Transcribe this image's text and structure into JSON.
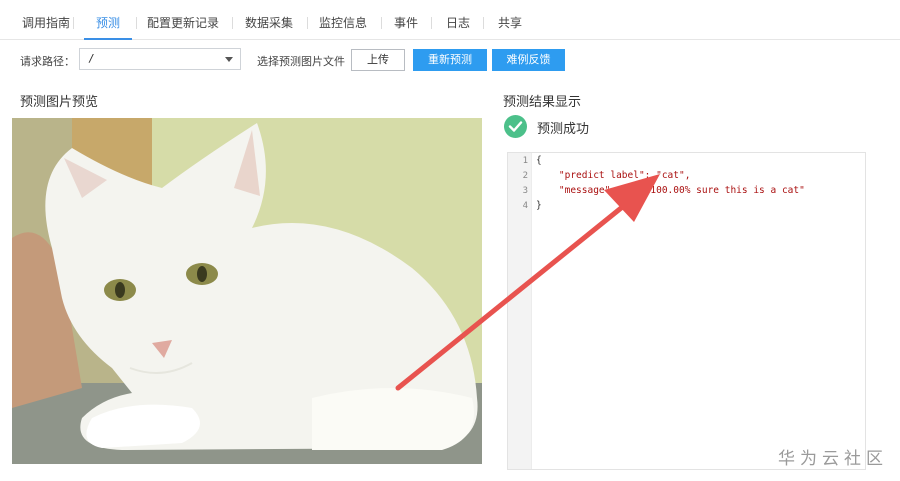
{
  "tabs": [
    {
      "label": "调用指南"
    },
    {
      "label": "预测",
      "active": true
    },
    {
      "label": "配置更新记录"
    },
    {
      "label": "数据采集"
    },
    {
      "label": "监控信息"
    },
    {
      "label": "事件"
    },
    {
      "label": "日志"
    },
    {
      "label": "共享"
    }
  ],
  "toolbar": {
    "path_label": "请求路径：",
    "path_value": "/",
    "file_label": "选择预测图片文件",
    "upload_button": "上传",
    "repredict_button": "重新预测",
    "feedback_button": "难例反馈"
  },
  "preview": {
    "title": "预测图片预览"
  },
  "result": {
    "title": "预测结果显示",
    "status": "预测成功",
    "code_lines": [
      {
        "num": "1",
        "text": "{"
      },
      {
        "num": "2",
        "text": "    \"predict label\": \"cat\","
      },
      {
        "num": "3",
        "text": "    \"message\": \"I   100.00% sure this is a cat\""
      },
      {
        "num": "4",
        "text": "}"
      }
    ]
  },
  "watermark": "华为云社区",
  "colors": {
    "accent": "#3a8fe6",
    "button_blue": "#2e9cf0",
    "success": "#4cc08a",
    "annotation_arrow": "#e8534f"
  }
}
